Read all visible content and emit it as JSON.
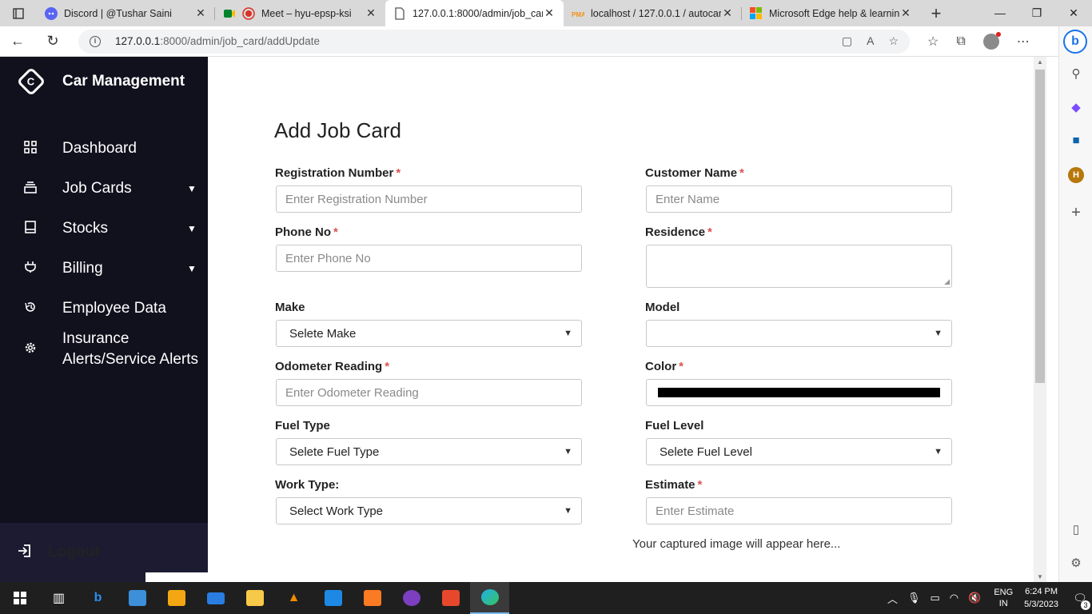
{
  "browser": {
    "tabs": [
      {
        "title": "Discord | @Tushar Saini",
        "icon": "discord-icon",
        "color": "#5865f2",
        "active": false
      },
      {
        "title": "Meet – hyu-epsp-ksi",
        "icon": "meet-icon",
        "color": "#00832d",
        "active": false
      },
      {
        "title": "127.0.0.1:8000/admin/job_car",
        "icon": "page-icon",
        "color": "#555555",
        "active": true
      },
      {
        "title": "localhost / 127.0.0.1 / autocar",
        "icon": "phpmyadmin-icon",
        "color": "#f29111",
        "active": false
      },
      {
        "title": "Microsoft Edge help & learnin",
        "icon": "microsoft-icon",
        "color": "#f25022",
        "active": false
      }
    ],
    "url_host": "127.0.0.1",
    "url_path": ":8000/admin/job_card/addUpdate"
  },
  "app": {
    "brand": "Car Management",
    "menu": [
      {
        "label": "Dashboard",
        "icon": "grid-icon",
        "has_children": false
      },
      {
        "label": "Job Cards",
        "icon": "stack-icon",
        "has_children": true
      },
      {
        "label": "Stocks",
        "icon": "box-icon",
        "has_children": true
      },
      {
        "label": "Billing",
        "icon": "plug-icon",
        "has_children": true
      },
      {
        "label": "Employee Data",
        "icon": "history-icon",
        "has_children": false
      },
      {
        "label": "Insurance Alerts/Service Alerts",
        "icon": "gear-icon",
        "has_children": false
      }
    ],
    "logout": "Logout"
  },
  "form": {
    "title": "Add Job Card",
    "registration": {
      "label": "Registration Number",
      "placeholder": "Enter Registration Number",
      "required": true
    },
    "customer": {
      "label": "Customer Name",
      "placeholder": "Enter Name",
      "required": true
    },
    "phone": {
      "label": "Phone No",
      "placeholder": "Enter Phone No",
      "required": true
    },
    "residence": {
      "label": "Residence",
      "placeholder": "",
      "required": true
    },
    "make": {
      "label": "Make",
      "selected": "Selete Make"
    },
    "model": {
      "label": "Model",
      "selected": ""
    },
    "odometer": {
      "label": "Odometer Reading",
      "placeholder": "Enter Odometer Reading",
      "required": true
    },
    "color": {
      "label": "Color",
      "value": "#000000",
      "required": true
    },
    "fuel_type": {
      "label": "Fuel Type",
      "selected": "Selete Fuel Type"
    },
    "fuel_level": {
      "label": "Fuel Level",
      "selected": "Selete Fuel Level"
    },
    "work_type": {
      "label": "Work Type:",
      "selected": "Select Work Type"
    },
    "estimate": {
      "label": "Estimate",
      "placeholder": "Enter Estimate",
      "required": true
    },
    "image_note": "Your captured image will appear here...",
    "required_mark": "*"
  },
  "taskbar": {
    "lang_top": "ENG",
    "lang_bottom": "IN",
    "time": "6:24 PM",
    "date": "5/3/2023",
    "notification_count": "3"
  }
}
